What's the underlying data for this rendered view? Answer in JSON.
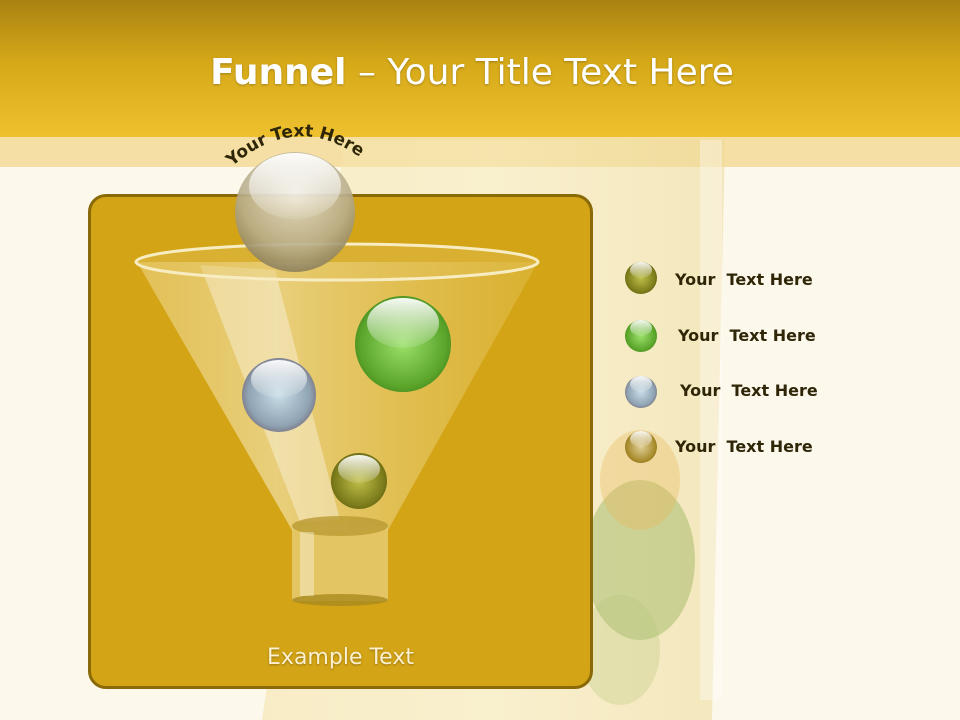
{
  "slide": {
    "title_bold": "Funnel",
    "title_separator": " – ",
    "title_rest": "Your Title Text Here",
    "arc_label": "Your Text Here",
    "example_text": "Example Text",
    "list": [
      {
        "label": "Your  Text Here",
        "color": "#6b6b12"
      },
      {
        "label": "Your  Text Here",
        "color": "#5aa42a"
      },
      {
        "label": "Your  Text Here",
        "color": "#8fa3b3"
      },
      {
        "label": "Your  Text Here",
        "color": "#a68a2a"
      }
    ]
  },
  "colors": {
    "header": "#d5a818",
    "panel": "#d3a416",
    "panel_border": "#8a6a06"
  }
}
